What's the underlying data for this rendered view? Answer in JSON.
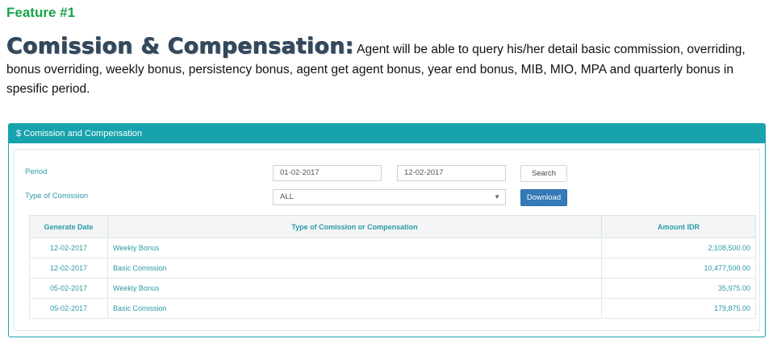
{
  "feature_label": "Feature #1",
  "intro": {
    "heading": "Comission & Compensation:",
    "description": "Agent will be able to query his/her detail basic commission, overriding, bonus overriding, weekly bonus, persistency bonus, agent get agent bonus, year end bonus, MIB, MIO, MPA and quarterly bonus in spesific period."
  },
  "panel": {
    "icon": "$",
    "title": "Comission and Compensation",
    "period_label": "Period",
    "period_from": "01-02-2017",
    "period_to": "12-02-2017",
    "search_label": "Search",
    "type_label": "Type of Comission",
    "type_value": "ALL",
    "download_label": "Download",
    "header_color": "#17a2ad",
    "download_color": "#337ab7"
  },
  "table": {
    "headers": [
      "Generate Date",
      "Type of Comission or Compensation",
      "Amount IDR"
    ],
    "rows": [
      {
        "date": "12-02-2017",
        "type": "Weekly Bonus",
        "amount": "2,108,500.00"
      },
      {
        "date": "12-02-2017",
        "type": "Basic Comission",
        "amount": "10,477,500.00"
      },
      {
        "date": "05-02-2017",
        "type": "Weekly Bonus",
        "amount": "35,975.00"
      },
      {
        "date": "05-02-2017",
        "type": "Basic Comission",
        "amount": "179,875.00"
      }
    ]
  }
}
